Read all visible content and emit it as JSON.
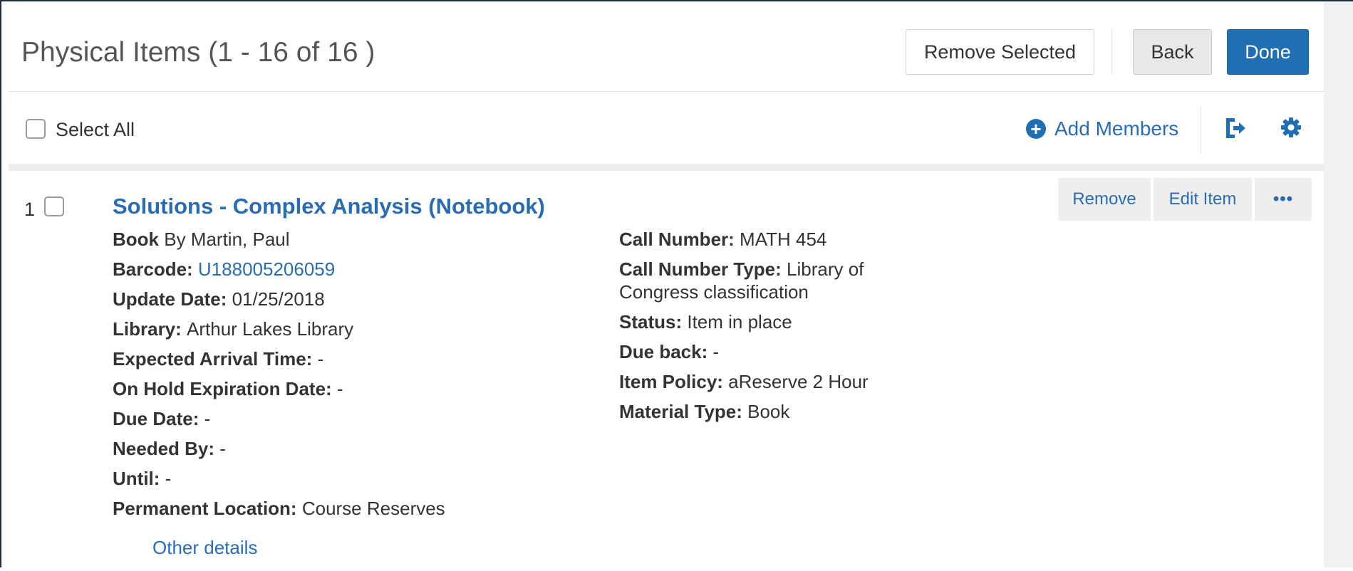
{
  "header": {
    "title": "Physical Items (1 - 16 of 16 )",
    "remove_selected_label": "Remove Selected",
    "back_label": "Back",
    "done_label": "Done"
  },
  "toolbar": {
    "select_all_label": "Select All",
    "add_members_label": "Add Members",
    "plus_glyph": "+",
    "icons": [
      "export-icon",
      "gear-icon"
    ]
  },
  "items": [
    {
      "index": "1",
      "title": "Solutions - Complex Analysis (Notebook)",
      "actions": {
        "remove": "Remove",
        "edit": "Edit Item",
        "more": "•••"
      },
      "left_fields": [
        {
          "label": "Book",
          "value": " By Martin, Paul"
        },
        {
          "label": "Barcode: ",
          "value": "U188005206059"
        },
        {
          "label": "Update Date: ",
          "value": "01/25/2018"
        },
        {
          "label": "Library: ",
          "value": "Arthur Lakes Library"
        },
        {
          "label": "Expected Arrival Time: ",
          "value": "-"
        },
        {
          "label": "On Hold Expiration Date: ",
          "value": "-"
        },
        {
          "label": "Due Date: ",
          "value": "-"
        },
        {
          "label": "Needed By: ",
          "value": "-"
        },
        {
          "label": "Until: ",
          "value": "-"
        },
        {
          "label": "Permanent Location: ",
          "value": "Course Reserves"
        }
      ],
      "right_fields": [
        {
          "label": "Call Number: ",
          "value": "MATH 454"
        },
        {
          "label": "Call Number Type: ",
          "value": "Library of Congress classification"
        },
        {
          "label": "Status: ",
          "value": "Item in place"
        },
        {
          "label": "Due back: ",
          "value": "-"
        },
        {
          "label": "Item Policy: ",
          "value": "aReserve 2 Hour"
        },
        {
          "label": "Material Type: ",
          "value": "Book"
        }
      ],
      "other_details_label": "Other details"
    }
  ],
  "colors": {
    "link": "#2a6cb3",
    "primary_button": "#1f6fb2",
    "text": "#333333"
  }
}
